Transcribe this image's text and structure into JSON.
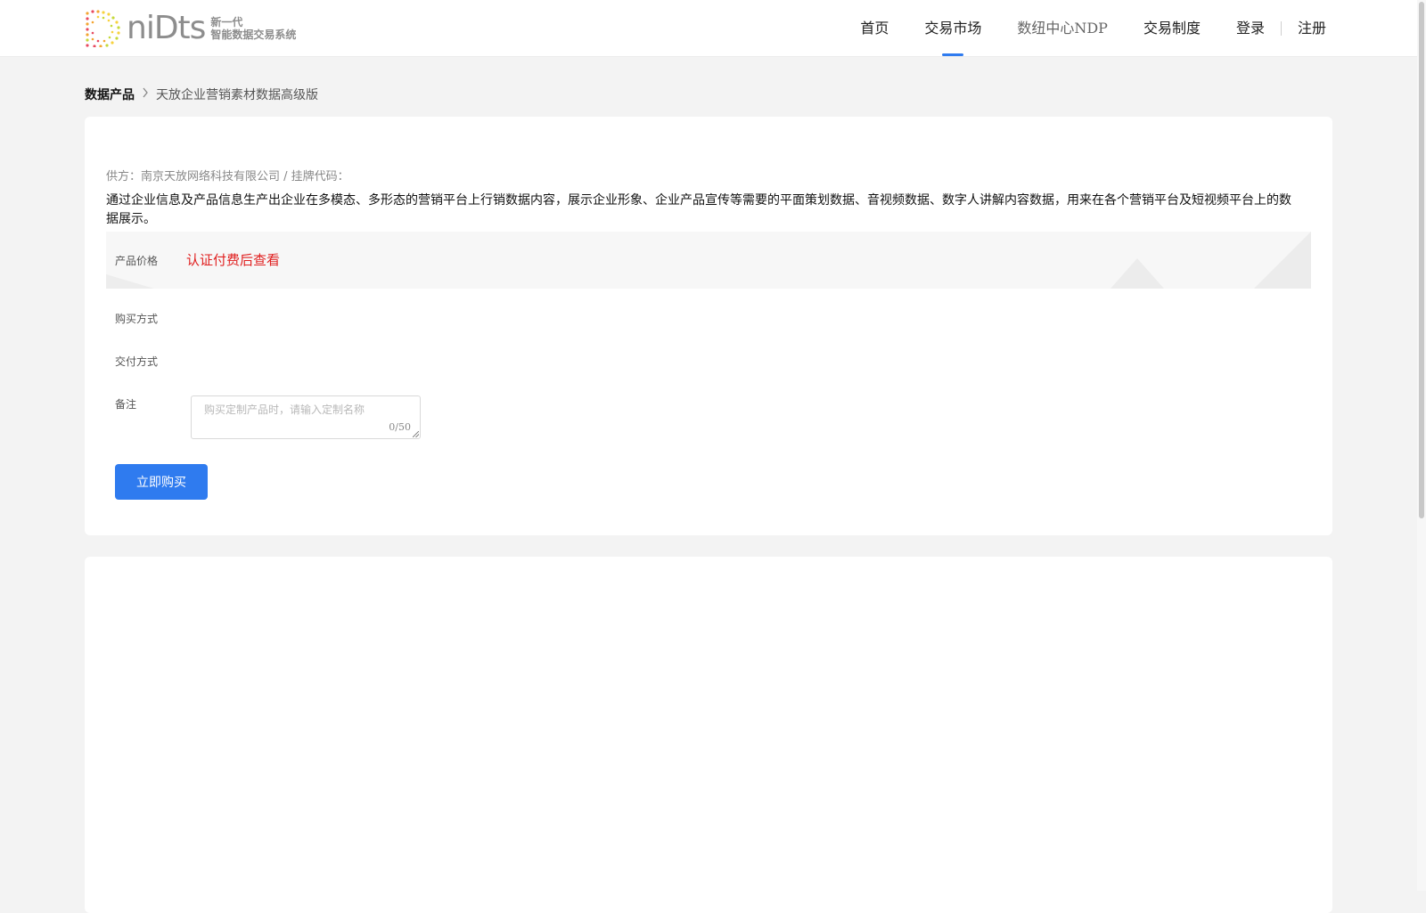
{
  "header": {
    "logo_word": "niDts",
    "logo_sub_line1": "新一代",
    "logo_sub_line2": "智能数据交易系统",
    "nav": [
      {
        "label": "首页"
      },
      {
        "label": "交易市场"
      },
      {
        "label": "数纽中心NDP"
      },
      {
        "label": "交易制度"
      }
    ],
    "login": "登录",
    "register": "注册",
    "active_color": "#2f7bef"
  },
  "breadcrumb": {
    "root": "数据产品",
    "separator_icon": "chevron-right-icon",
    "current": "天放企业营销素材数据高级版"
  },
  "product": {
    "supplier": "供方：南京天放网络科技有限公司 / 挂牌代码：",
    "description": "通过企业信息及产品信息生产出企业在多模态、多形态的营销平台上行销数据内容，展示企业形象、企业产品宣传等需要的平面策划数据、音视频数据、数字人讲解内容数据，用来在各个营销平台及短视频平台上的数据展示。",
    "price_label": "产品价格",
    "price_value": "认证付费后查看",
    "price_color": "#e02020",
    "buy_method_label": "购买方式",
    "delivery_label": "交付方式",
    "note_label": "备注",
    "note_placeholder": "购买定制产品时，请输入定制名称",
    "note_count": "0/50",
    "buy_button": "立即购买"
  }
}
